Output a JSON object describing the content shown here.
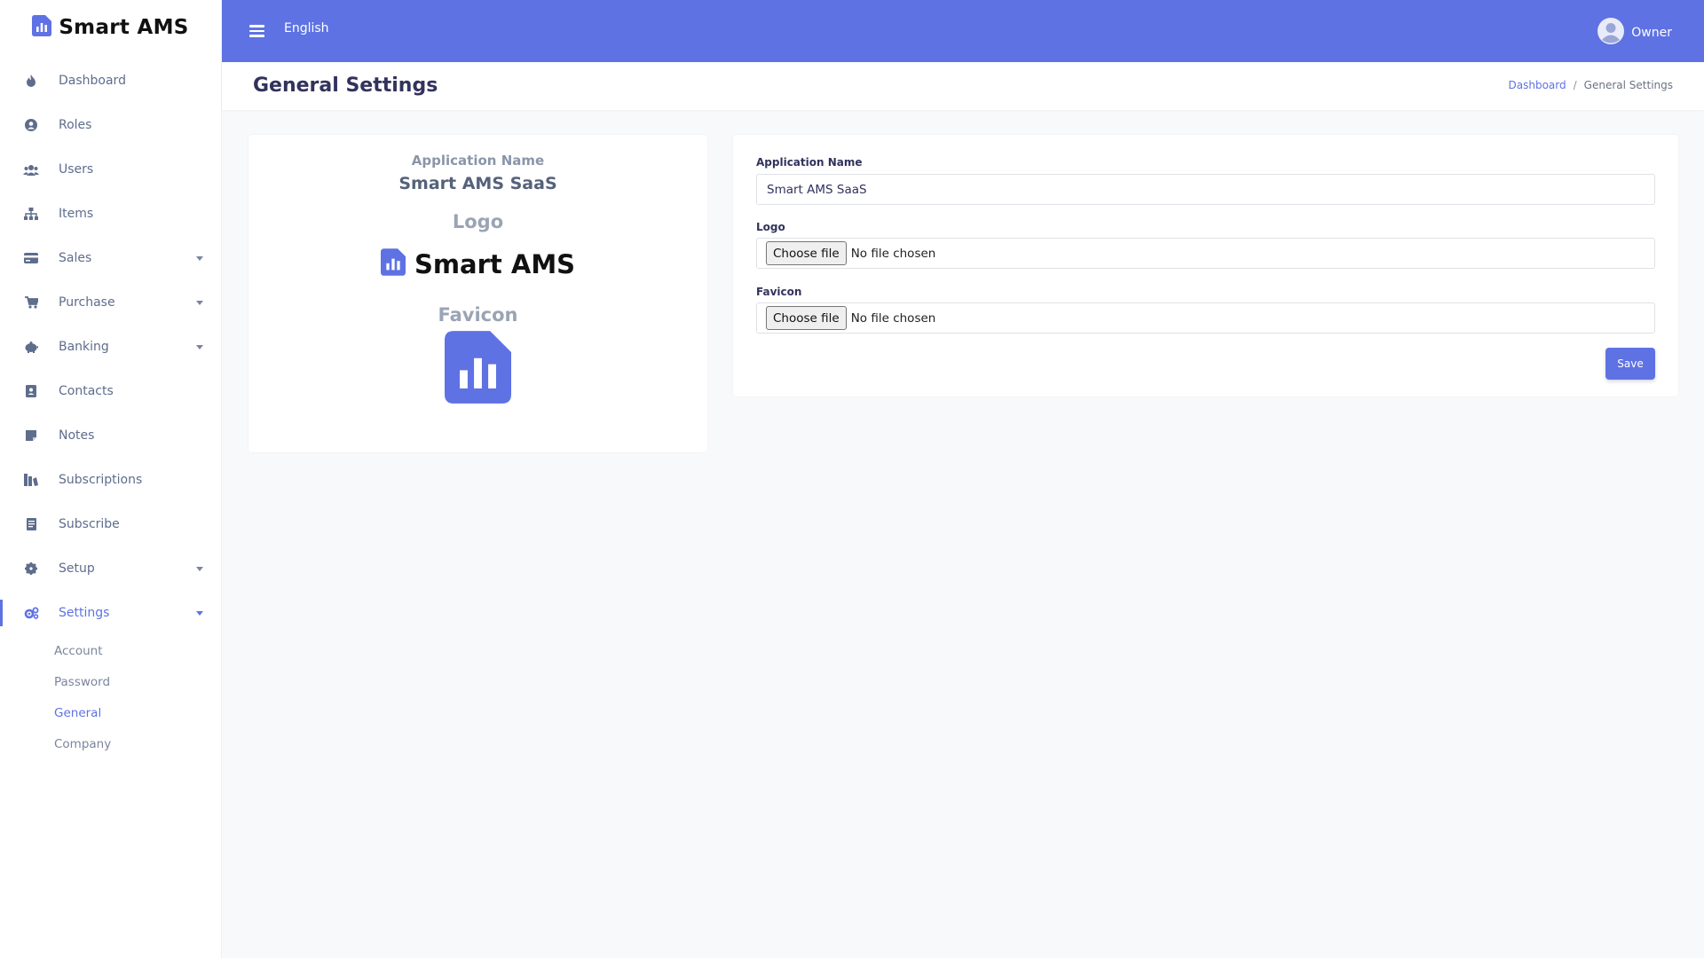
{
  "app": {
    "name": "Smart AMS"
  },
  "sidebar": {
    "items": [
      {
        "label": "Dashboard",
        "icon": "flame-icon"
      },
      {
        "label": "Roles",
        "icon": "user-circle-icon"
      },
      {
        "label": "Users",
        "icon": "users-icon"
      },
      {
        "label": "Items",
        "icon": "sitemap-icon"
      },
      {
        "label": "Sales",
        "icon": "credit-card-icon"
      },
      {
        "label": "Purchase",
        "icon": "cart-icon"
      },
      {
        "label": "Banking",
        "icon": "piggy-bank-icon"
      },
      {
        "label": "Contacts",
        "icon": "address-book-icon"
      },
      {
        "label": "Notes",
        "icon": "sticky-note-icon"
      },
      {
        "label": "Subscriptions",
        "icon": "subscriptions-icon"
      },
      {
        "label": "Subscribe",
        "icon": "receipt-icon"
      },
      {
        "label": "Setup",
        "icon": "gear-icon"
      },
      {
        "label": "Settings",
        "icon": "gears-icon"
      }
    ],
    "settings_sub": [
      "Account",
      "Password",
      "General",
      "Company"
    ]
  },
  "topbar": {
    "language": "English",
    "user": "Owner"
  },
  "header": {
    "title": "General Settings",
    "breadcrumb": {
      "home": "Dashboard",
      "separator": "/",
      "current": "General Settings"
    }
  },
  "preview": {
    "app_name_label": "Application Name",
    "app_name_value": "Smart AMS SaaS",
    "logo_heading": "Logo",
    "logo_text": "Smart AMS",
    "favicon_heading": "Favicon"
  },
  "form": {
    "app_name_label": "Application Name",
    "app_name_value": "Smart AMS SaaS",
    "logo_label": "Logo",
    "favicon_label": "Favicon",
    "choose_file": "Choose file",
    "no_file": "No file chosen",
    "save": "Save"
  },
  "colors": {
    "primary": "#5e72e4",
    "text_dark": "#32325d",
    "background": "#f8f9fb"
  }
}
